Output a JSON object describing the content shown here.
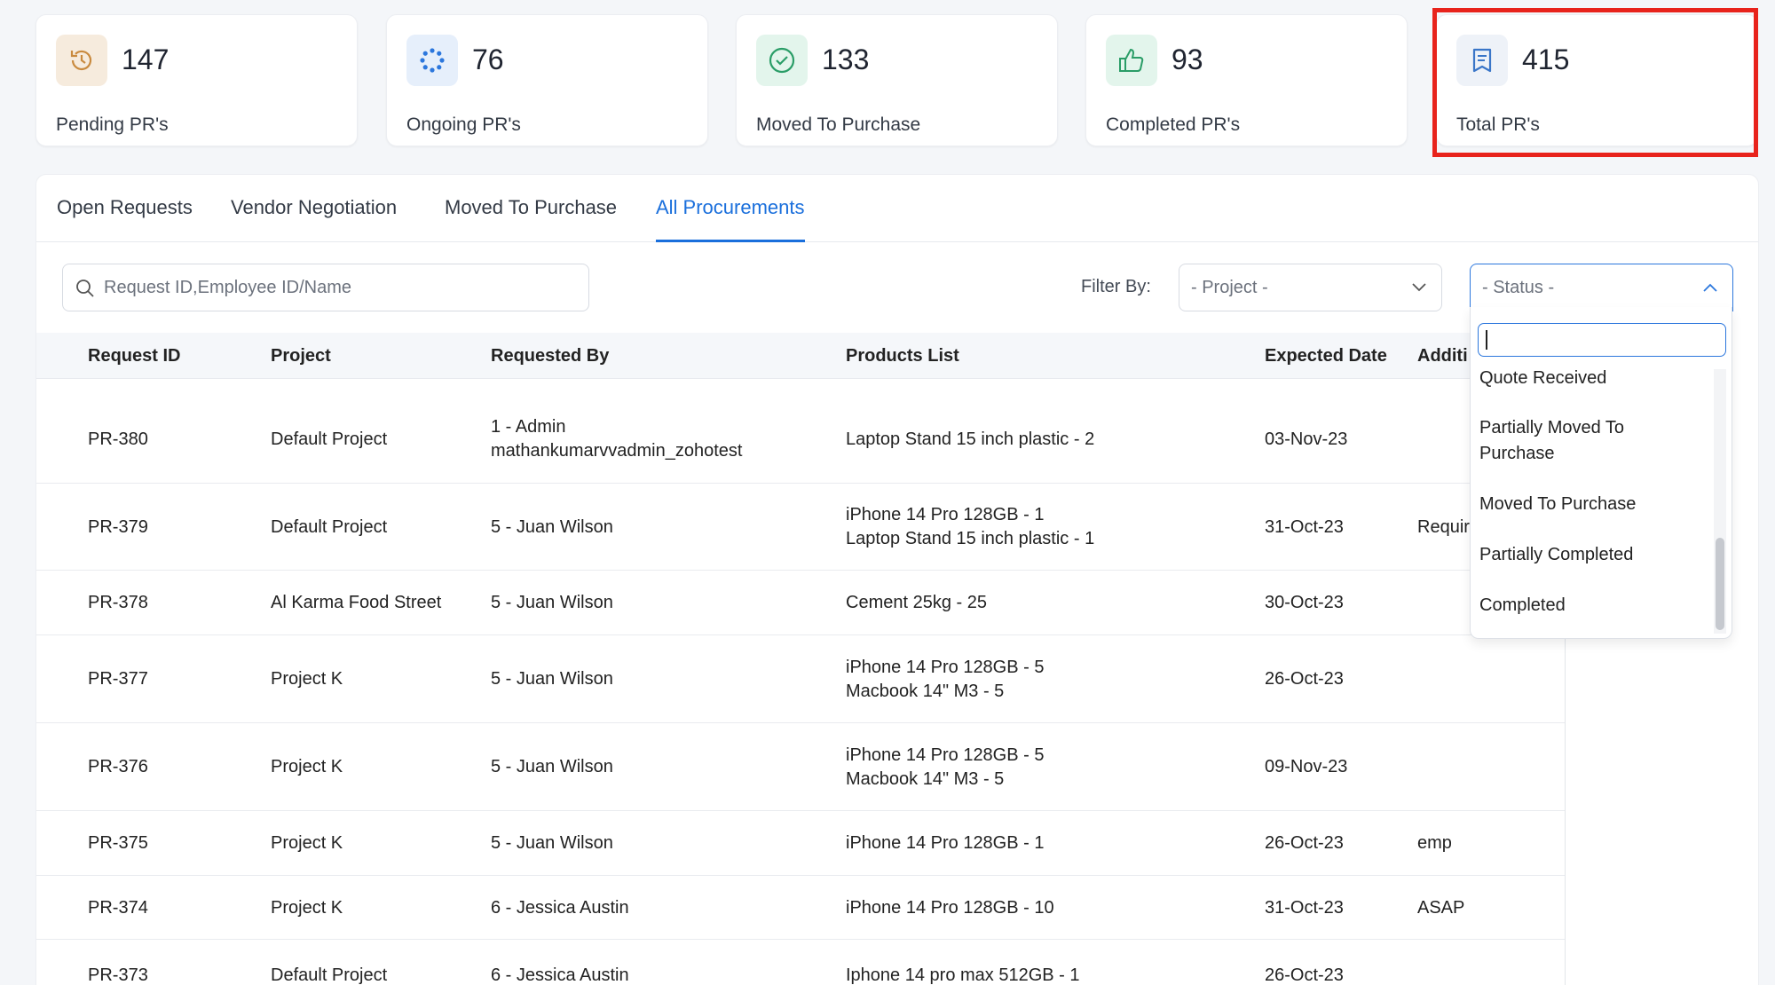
{
  "stats": [
    {
      "value": "147",
      "label": "Pending PR's",
      "icon": "history-icon",
      "color": "#f6ebdd"
    },
    {
      "value": "76",
      "label": "Ongoing PR's",
      "icon": "loading-dots-icon",
      "color": "#e6effb"
    },
    {
      "value": "133",
      "label": "Moved To Purchase",
      "icon": "check-circle-icon",
      "color": "#e3f5ec"
    },
    {
      "value": "93",
      "label": "Completed PR's",
      "icon": "thumbs-up-icon",
      "color": "#e3f5ec"
    },
    {
      "value": "415",
      "label": "Total PR's",
      "icon": "bookmark-doc-icon",
      "color": "#eef2f8"
    }
  ],
  "tabs": [
    "Open Requests",
    "Vendor Negotiation",
    "Moved To Purchase",
    "All Procurements"
  ],
  "active_tab": "All Procurements",
  "search": {
    "placeholder": "Request ID,Employee ID/Name"
  },
  "filter": {
    "label": "Filter By:",
    "project_placeholder": "- Project -",
    "status_placeholder": "- Status -"
  },
  "table": {
    "headers": [
      "Request ID",
      "Project",
      "Requested By",
      "Products List",
      "Expected Date",
      "Additi"
    ],
    "rows": [
      {
        "id": "PR-380",
        "project": "Default Project",
        "requested_by": [
          "1 - Admin",
          "mathankumarvvadmin_zohotest"
        ],
        "products": [
          "Laptop Stand 15 inch plastic - 2"
        ],
        "date": "03-Nov-23",
        "additional": ""
      },
      {
        "id": "PR-379",
        "project": "Default Project",
        "requested_by": [
          "5 - Juan Wilson"
        ],
        "products": [
          "iPhone 14 Pro 128GB - 1",
          "Laptop Stand 15 inch plastic - 1"
        ],
        "date": "31-Oct-23",
        "additional": "Requir"
      },
      {
        "id": "PR-378",
        "project": "Al Karma Food Street",
        "requested_by": [
          "5 - Juan Wilson"
        ],
        "products": [
          "Cement 25kg - 25"
        ],
        "date": "30-Oct-23",
        "additional": ""
      },
      {
        "id": "PR-377",
        "project": "Project K",
        "requested_by": [
          "5 - Juan Wilson"
        ],
        "products": [
          "iPhone 14 Pro 128GB - 5",
          "Macbook 14\" M3 - 5"
        ],
        "date": "26-Oct-23",
        "additional": ""
      },
      {
        "id": "PR-376",
        "project": "Project K",
        "requested_by": [
          "5 - Juan Wilson"
        ],
        "products": [
          "iPhone 14 Pro 128GB - 5",
          "Macbook 14\" M3 - 5"
        ],
        "date": "09-Nov-23",
        "additional": ""
      },
      {
        "id": "PR-375",
        "project": "Project K",
        "requested_by": [
          "5 - Juan Wilson"
        ],
        "products": [
          "iPhone 14 Pro 128GB - 1"
        ],
        "date": "26-Oct-23",
        "additional": "emp"
      },
      {
        "id": "PR-374",
        "project": "Project K",
        "requested_by": [
          "6 - Jessica Austin"
        ],
        "products": [
          "iPhone 14 Pro 128GB - 10"
        ],
        "date": "31-Oct-23",
        "additional": "ASAP"
      },
      {
        "id": "PR-373",
        "project": "Default Project",
        "requested_by": [
          "6 - Jessica Austin"
        ],
        "products": [
          "Iphone 14 pro max 512GB - 1"
        ],
        "date": "26-Oct-23",
        "additional": ""
      }
    ]
  },
  "status_dropdown": {
    "options": [
      "Quote Received",
      "Partially Moved To Purchase",
      "Moved To Purchase",
      "Partially Completed",
      "Completed"
    ]
  },
  "colors": {
    "accent": "#1a6fdc",
    "highlight": "#e8231c"
  }
}
